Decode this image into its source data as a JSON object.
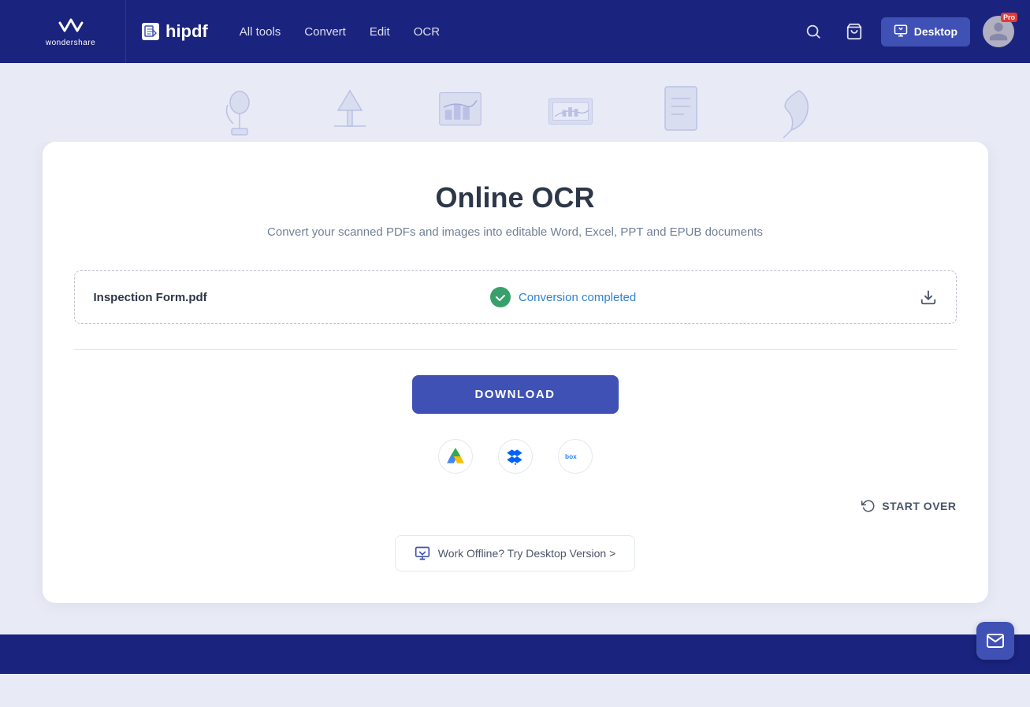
{
  "brand": {
    "wondershare_label": "wondershare",
    "hipdf_label": "hipdf"
  },
  "nav": {
    "all_tools": "All tools",
    "convert": "Convert",
    "edit": "Edit",
    "ocr": "OCR",
    "desktop_btn": "Desktop"
  },
  "hero": {
    "title": "Online OCR",
    "subtitle": "Convert your scanned PDFs and images into editable Word, Excel, PPT and EPUB documents"
  },
  "file_row": {
    "file_name": "Inspection Form.pdf",
    "status_text_1": "Conversion ",
    "status_highlight": "completed"
  },
  "actions": {
    "download_btn": "DOWNLOAD",
    "start_over_btn": "START OVER",
    "offline_text": "Work Offline? Try Desktop Version >"
  },
  "pro_badge": "Pro"
}
